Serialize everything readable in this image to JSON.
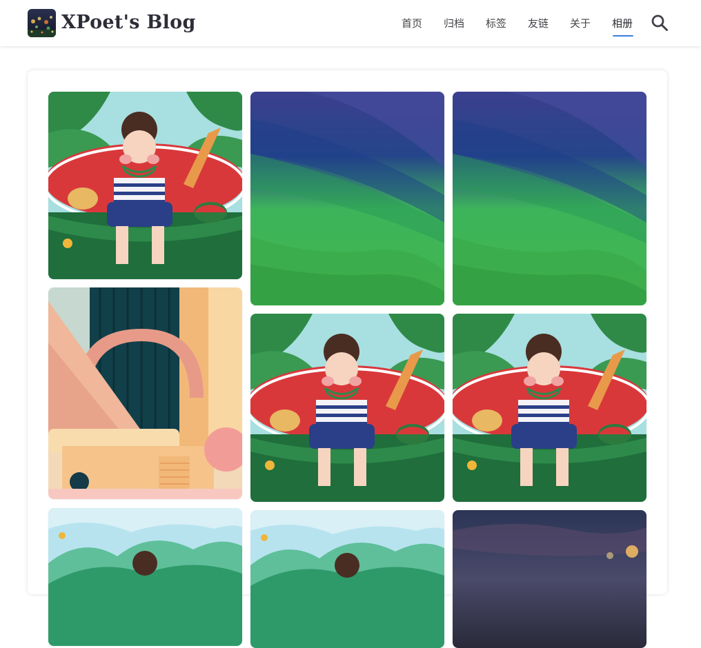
{
  "site": {
    "title": "XPoet's Blog"
  },
  "nav": {
    "items": [
      {
        "label": "首页"
      },
      {
        "label": "归档"
      },
      {
        "label": "标签"
      },
      {
        "label": "友链"
      },
      {
        "label": "关于"
      },
      {
        "label": "相册",
        "active": true
      }
    ]
  },
  "colors": {
    "accent": "#3c7ee0",
    "title": "#2d2d38",
    "nav_text": "#44444a"
  },
  "icons": {
    "search": "search-icon",
    "logo": "site-logo"
  },
  "gallery": {
    "photos": [
      {
        "scene": "watermelon-boy"
      },
      {
        "scene": "green-abstract-waves"
      },
      {
        "scene": "green-abstract-waves"
      },
      {
        "scene": "peach-3d-room"
      },
      {
        "scene": "watermelon-boy"
      },
      {
        "scene": "watermelon-boy"
      },
      {
        "scene": "sky-hills-boy"
      },
      {
        "scene": "sky-hills-boy"
      },
      {
        "scene": "dusk-lights"
      }
    ]
  }
}
